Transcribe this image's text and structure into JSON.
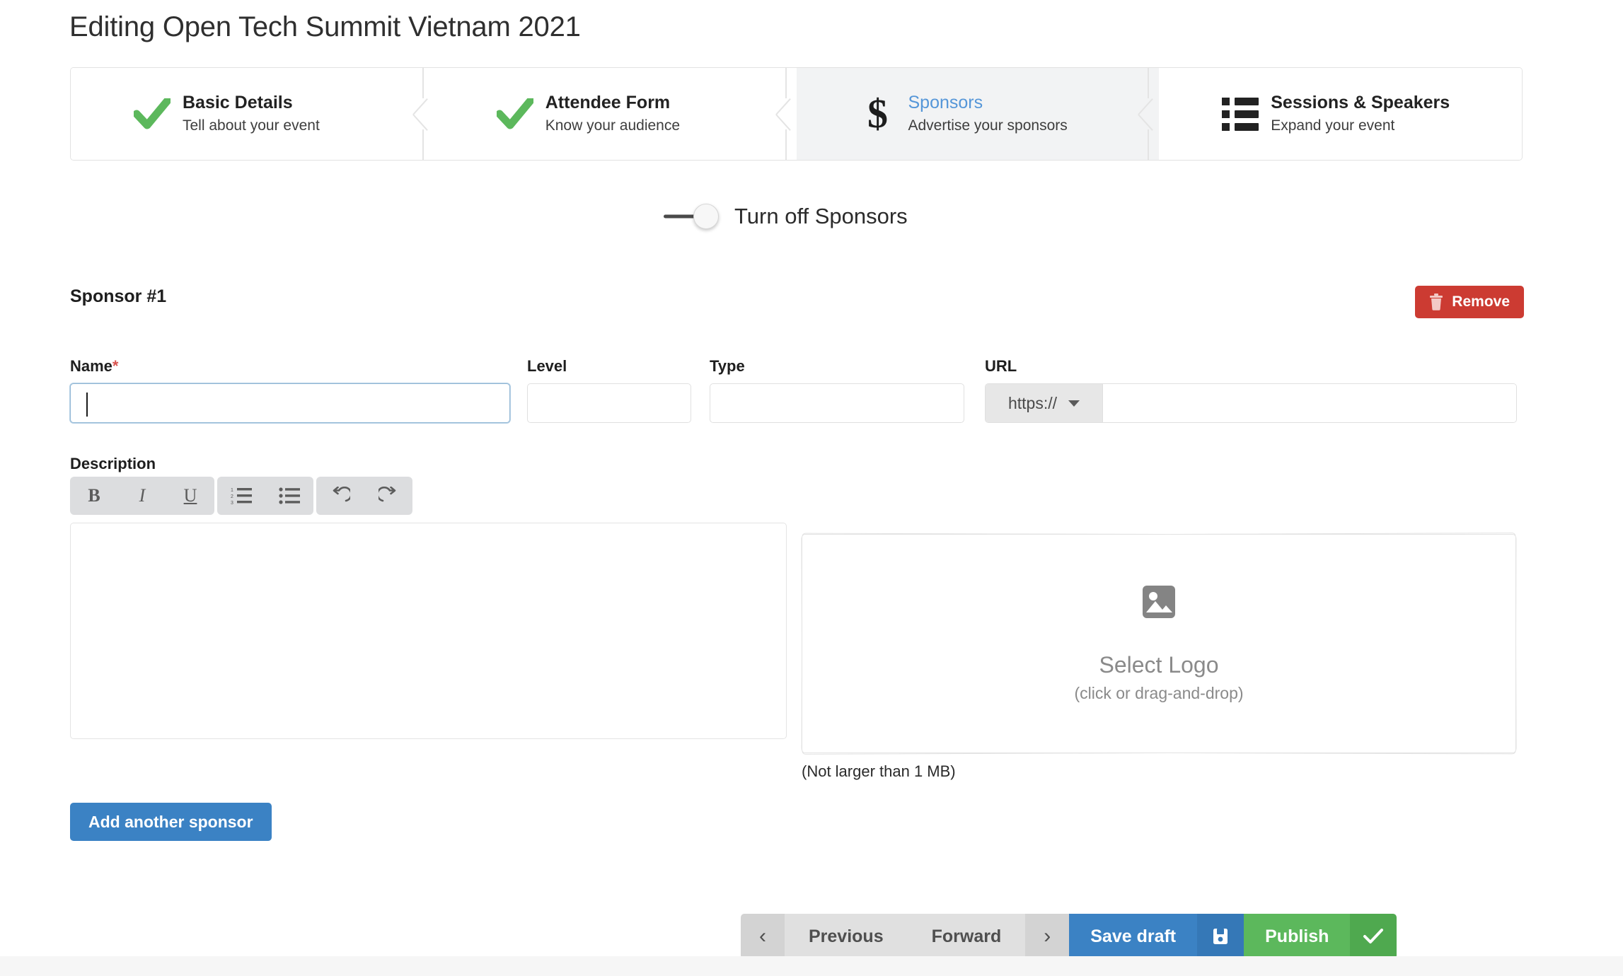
{
  "header": {
    "title": "Editing Open Tech Summit Vietnam 2021"
  },
  "wizard": {
    "steps": [
      {
        "icon": "check-icon",
        "name": "Basic Details",
        "sub": "Tell about your event",
        "state": "complete"
      },
      {
        "icon": "check-icon",
        "name": "Attendee Form",
        "sub": "Know your audience",
        "state": "complete"
      },
      {
        "icon": "dollar-icon",
        "name": "Sponsors",
        "sub": "Advertise your sponsors",
        "state": "active"
      },
      {
        "icon": "list-icon",
        "name": "Sessions & Speakers",
        "sub": "Expand your event",
        "state": "upcoming"
      }
    ]
  },
  "toggle": {
    "label": "Turn off Sponsors",
    "state": "on"
  },
  "sponsor": {
    "heading": "Sponsor #1",
    "remove_label": "Remove",
    "fields": {
      "name_label": "Name",
      "name_required_mark": "*",
      "name_value": "",
      "name_placeholder": "",
      "level_label": "Level",
      "level_value": "",
      "level_placeholder": "",
      "type_label": "Type",
      "type_value": "",
      "type_placeholder": "",
      "url_label": "URL",
      "url_scheme": "https://",
      "url_value": "",
      "url_placeholder": ""
    },
    "description": {
      "label": "Description",
      "value": "",
      "toolbar": [
        {
          "icon": "bold-icon",
          "label": "B"
        },
        {
          "icon": "italic-icon",
          "label": "I"
        },
        {
          "icon": "underline-icon",
          "label": "U"
        },
        {
          "icon": "ordered-list-icon",
          "label": ""
        },
        {
          "icon": "unordered-list-icon",
          "label": ""
        },
        {
          "icon": "undo-icon",
          "label": ""
        },
        {
          "icon": "redo-icon",
          "label": ""
        }
      ]
    },
    "logo": {
      "icon": "picture-icon",
      "title": "Select Logo",
      "subtitle": "(click or drag-and-drop)",
      "note": "(Not larger than 1 MB)"
    },
    "add_label": "Add another sponsor"
  },
  "footer": {
    "prev_chevron": "‹",
    "previous_label": "Previous",
    "forward_label": "Forward",
    "next_chevron": "›",
    "save_label": "Save draft",
    "save_icon": "floppy-disk-icon",
    "publish_label": "Publish",
    "publish_icon": "check-icon"
  },
  "colors": {
    "accent_blue": "#3b82c4",
    "active_step_blue": "#5596d8",
    "danger_red": "#cc3b32",
    "success_green": "#5cb85c",
    "check_green": "#5cb85c",
    "required_red": "#d9534f"
  }
}
